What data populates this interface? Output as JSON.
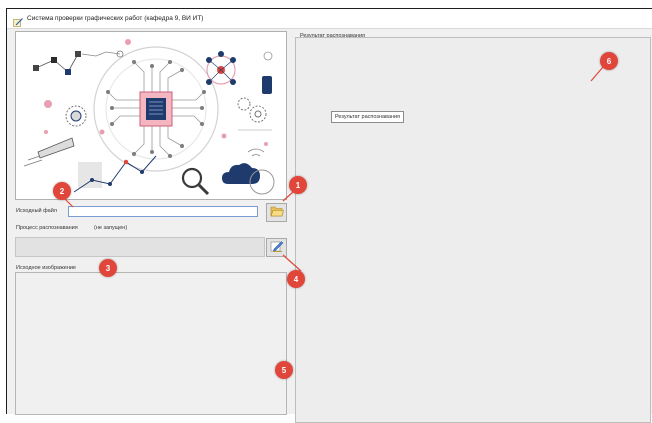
{
  "window": {
    "title": "Система проверки графических работ (кафедра 9, ВИ ИТ)"
  },
  "left": {
    "source_file_label": "Исходный файл",
    "source_file_value": "",
    "progress_label": "Процесс распознавания",
    "progress_status": "(не запущен)",
    "source_image_label": "Исходное изображение"
  },
  "right": {
    "result_label": "Результат распознавания",
    "tooltip": "Результат распознавания"
  },
  "markers": [
    "1",
    "2",
    "3",
    "4",
    "5",
    "6"
  ],
  "icons": {
    "open_file": "folder-open-icon",
    "recognize": "edit-pencil-icon",
    "app": "app-icon"
  },
  "colors": {
    "marker": "#e1463b",
    "accent_pink": "#e8a0b0",
    "accent_navy": "#1f3b6e"
  }
}
